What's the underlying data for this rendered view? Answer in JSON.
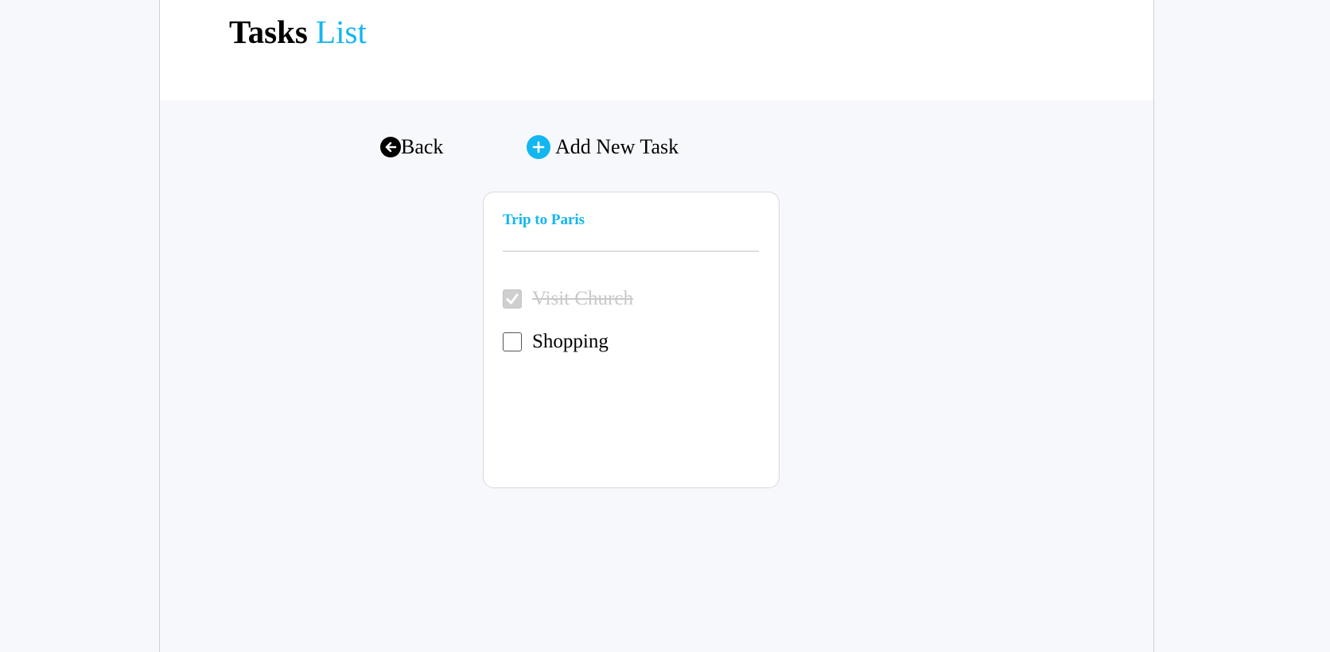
{
  "header": {
    "title_main": "Tasks",
    "title_accent": "List"
  },
  "nav": {
    "back_label": "Back",
    "add_label": "Add New Task"
  },
  "list": {
    "title": "Trip to Paris",
    "tasks": [
      {
        "label": "Visit Church",
        "checked": true
      },
      {
        "label": "Shopping",
        "checked": false
      }
    ]
  },
  "colors": {
    "accent": "#12b6f0",
    "background": "#f7f8fc",
    "card": "#ffffff",
    "done_text": "#c9c9c9"
  },
  "icons": {
    "back": "arrow-left-circle-icon",
    "add": "plus-circle-icon",
    "check": "check-icon"
  }
}
